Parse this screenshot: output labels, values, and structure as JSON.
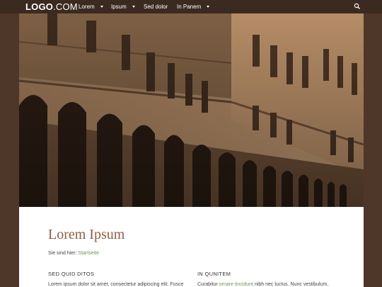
{
  "nav": {
    "logo_bold": "LOGO",
    "logo_rest": ".COM",
    "items": [
      {
        "label": "Lorem",
        "has_dropdown": true
      },
      {
        "label": "Ipsum",
        "has_dropdown": true
      },
      {
        "label": "Sed dolor",
        "has_dropdown": false
      },
      {
        "label": "In Panem",
        "has_dropdown": true
      }
    ],
    "search_icon": "search-icon"
  },
  "hero": {
    "image": "building-facade-photo"
  },
  "page": {
    "title": "Lorem Ipsum",
    "breadcrumb_prefix": "Sie sind hier:",
    "breadcrumb_link": "Startseite"
  },
  "columns": [
    {
      "heading": "SED QUID DITOS",
      "text": "Lorem ipsum dolor sit amet, consectetur adipiscing elit. Fusce"
    },
    {
      "heading": "IN QUNITEM",
      "text_before": "Curabitur",
      "link": "ornare tincidunt",
      "text_after": "nibh nec luctus. Nunc vestibulum,"
    }
  ],
  "colors": {
    "nav_bg": "#3b2a20",
    "page_bg": "#4e3629",
    "title": "#8d5d47",
    "link": "#6a9a4c"
  }
}
